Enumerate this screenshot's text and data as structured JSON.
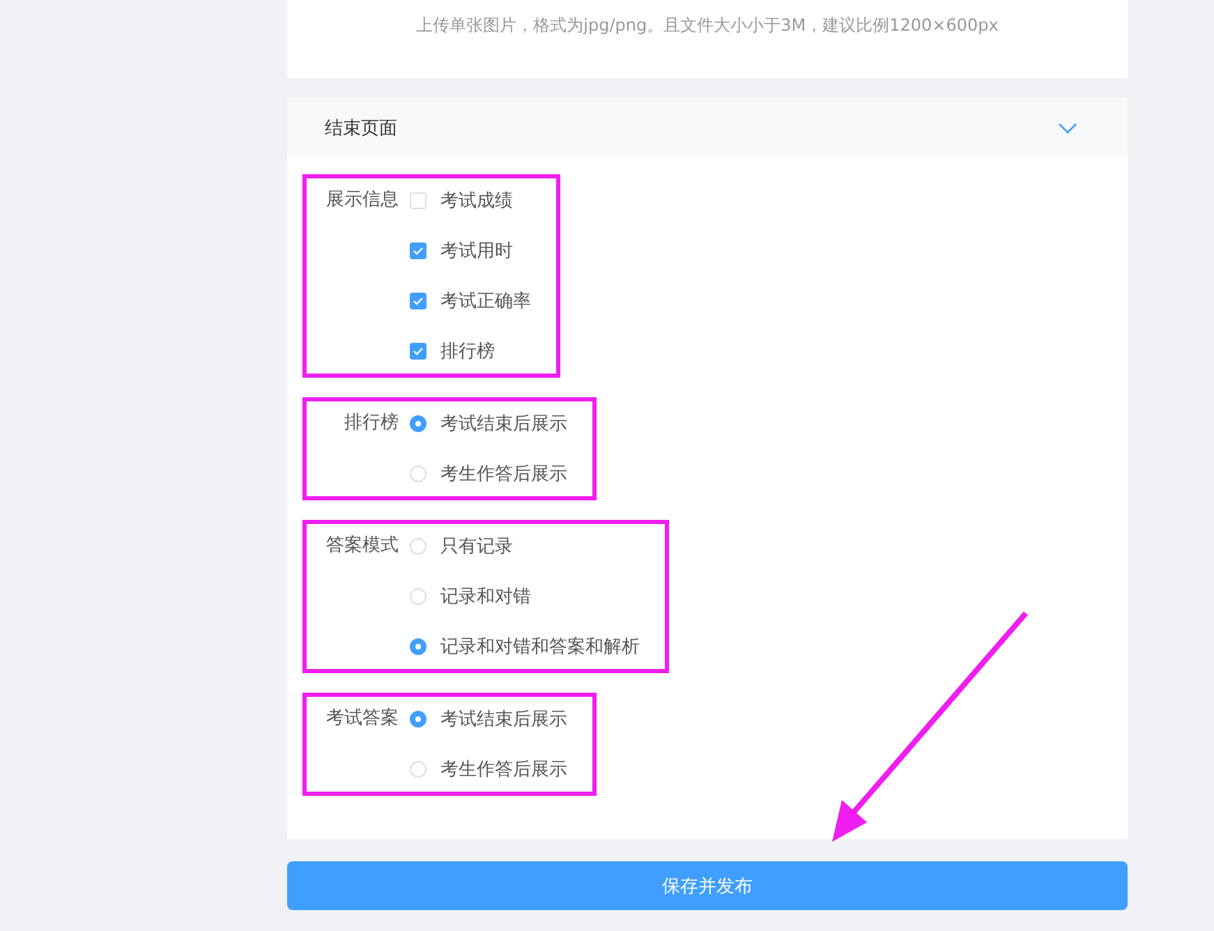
{
  "upload_hint": "上传单张图片，格式为jpg/png。且文件大小小于3M，建议比例1200×600px",
  "section": {
    "title": "结束页面",
    "expanded": true
  },
  "groups": [
    {
      "label": "展示信息",
      "kind": "checkbox",
      "highlighted": true,
      "options": [
        {
          "label": "考试成绩",
          "checked": false
        },
        {
          "label": "考试用时",
          "checked": true
        },
        {
          "label": "考试正确率",
          "checked": true
        },
        {
          "label": "排行榜",
          "checked": true
        }
      ]
    },
    {
      "label": "排行榜",
      "kind": "radio",
      "highlighted": true,
      "options": [
        {
          "label": "考试结束后展示",
          "selected": true
        },
        {
          "label": "考生作答后展示",
          "selected": false
        }
      ]
    },
    {
      "label": "答案模式",
      "kind": "radio",
      "highlighted": true,
      "options": [
        {
          "label": "只有记录",
          "selected": false
        },
        {
          "label": "记录和对错",
          "selected": false
        },
        {
          "label": "记录和对错和答案和解析",
          "selected": true
        }
      ]
    },
    {
      "label": "考试答案",
      "kind": "radio",
      "highlighted": true,
      "options": [
        {
          "label": "考试结束后展示",
          "selected": true
        },
        {
          "label": "考生作答后展示",
          "selected": false
        }
      ]
    }
  ],
  "submit_button": "保存并发布",
  "arrow": true
}
